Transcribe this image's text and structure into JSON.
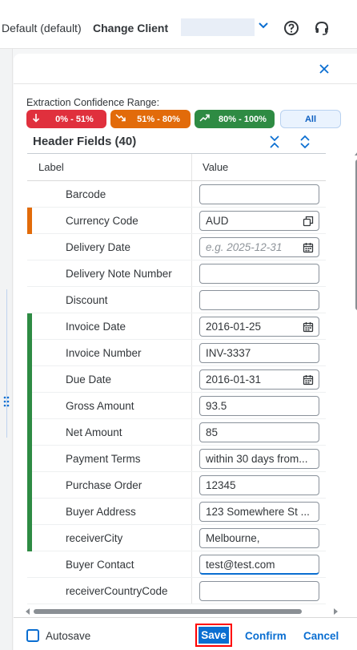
{
  "header": {
    "client_text": "Default (default)",
    "change_client_label": "Change Client",
    "client_select_value": ""
  },
  "confidence": {
    "label": "Extraction Confidence Range:",
    "chips": [
      {
        "label": "0% - 51%",
        "color": "#e0303d",
        "icon": "arrow-down-icon"
      },
      {
        "label": "51% - 80%",
        "color": "#e26b0a",
        "icon": "trend-down-icon"
      },
      {
        "label": "80% - 100%",
        "color": "#2e8b43",
        "icon": "trend-up-icon"
      },
      {
        "label": "All",
        "color": "#eaf3fe",
        "icon": ""
      }
    ]
  },
  "section": {
    "title": "Header Fields (40)"
  },
  "table": {
    "columns": [
      "Label",
      "Value"
    ],
    "rows": [
      {
        "label": "Barcode",
        "value": "",
        "placeholder": "",
        "confidence": "none"
      },
      {
        "label": "Currency Code",
        "value": "AUD",
        "placeholder": "",
        "confidence": "medium",
        "trailing_icon": "value-help-icon"
      },
      {
        "label": "Delivery Date",
        "value": "",
        "placeholder": "e.g. 2025-12-31",
        "confidence": "none",
        "trailing_icon": "calendar-icon"
      },
      {
        "label": "Delivery Note Number",
        "value": "",
        "placeholder": "",
        "confidence": "none"
      },
      {
        "label": "Discount",
        "value": "",
        "placeholder": "",
        "confidence": "none"
      },
      {
        "label": "Invoice Date",
        "value": "2016-01-25",
        "placeholder": "",
        "confidence": "high",
        "trailing_icon": "calendar-icon"
      },
      {
        "label": "Invoice Number",
        "value": "INV-3337",
        "placeholder": "",
        "confidence": "high"
      },
      {
        "label": "Due Date",
        "value": "2016-01-31",
        "placeholder": "",
        "confidence": "high",
        "trailing_icon": "calendar-icon"
      },
      {
        "label": "Gross Amount",
        "value": "93.5",
        "placeholder": "",
        "confidence": "high"
      },
      {
        "label": "Net Amount",
        "value": "85",
        "placeholder": "",
        "confidence": "high"
      },
      {
        "label": "Payment Terms",
        "value": "within 30 days from...",
        "placeholder": "",
        "confidence": "high"
      },
      {
        "label": "Purchase Order",
        "value": "12345",
        "placeholder": "",
        "confidence": "high"
      },
      {
        "label": "Buyer Address",
        "value": "123 Somewhere St ...",
        "placeholder": "",
        "confidence": "high"
      },
      {
        "label": "receiverCity",
        "value": "Melbourne,",
        "placeholder": "",
        "confidence": "high"
      },
      {
        "label": "Buyer Contact",
        "value": "test@test.com",
        "placeholder": "",
        "confidence": "none",
        "active": true
      },
      {
        "label": "receiverCountryCode",
        "value": "",
        "placeholder": "",
        "confidence": "none"
      }
    ]
  },
  "colors": {
    "high": "#2e8b43",
    "medium": "#e26b0a",
    "low": "#e0303d",
    "accent": "#0a6ed1"
  },
  "footer": {
    "autosave_label": "Autosave",
    "autosave_checked": false,
    "save_label": "Save",
    "confirm_label": "Confirm",
    "cancel_label": "Cancel"
  }
}
